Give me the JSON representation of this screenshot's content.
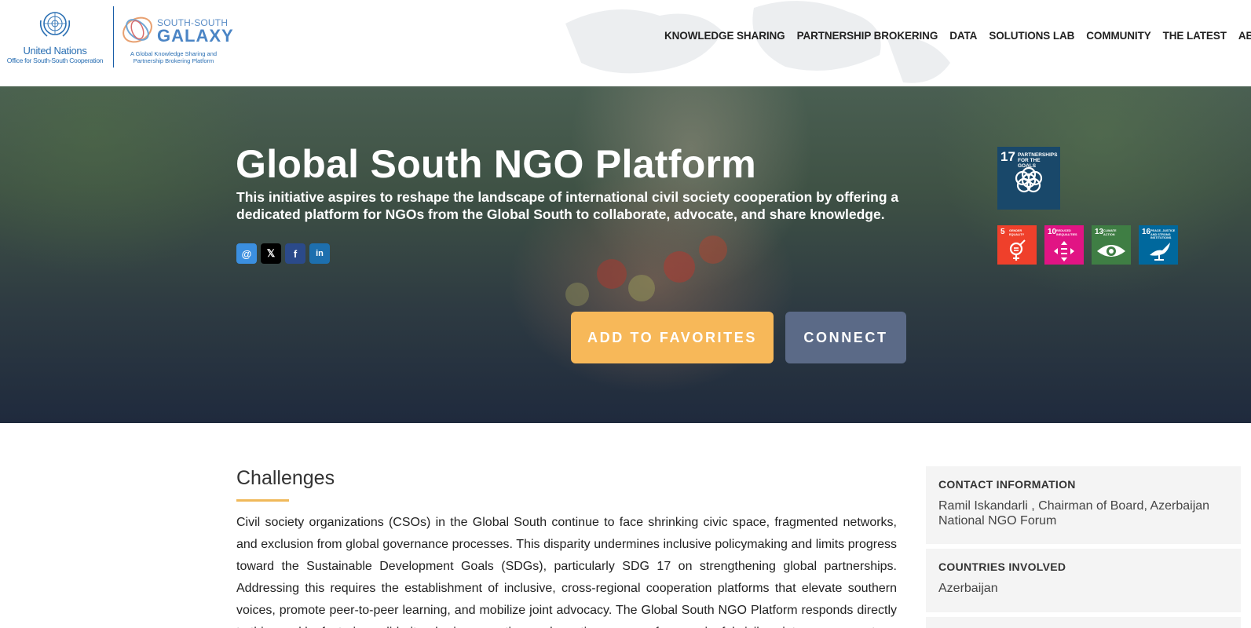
{
  "header": {
    "un_logo": {
      "name": "United Nations",
      "subtitle": "Office for South-South Cooperation"
    },
    "ssg_logo": {
      "top": "SOUTH-SOUTH",
      "brand": "GALAXY",
      "tagline": "A Global Knowledge Sharing and Partnership Brokering Platform"
    },
    "nav": [
      "KNOWLEDGE SHARING",
      "PARTNERSHIP BROKERING",
      "DATA",
      "SOLUTIONS LAB",
      "COMMUNITY",
      "THE LATEST",
      "ABOUT"
    ]
  },
  "hero": {
    "title": "Global South NGO Platform",
    "description": "This initiative aspires to reshape the landscape of international civil society cooperation by offering a dedicated platform for NGOs from the Global South to collaborate, advocate, and share knowledge.",
    "share": {
      "email_icon": "@",
      "x_icon": "𝕏",
      "facebook_icon": "f",
      "linkedin_icon": "in"
    },
    "buttons": {
      "favorites": "ADD TO FAVORITES",
      "connect": "CONNECT"
    },
    "sdgs": [
      {
        "number": "17",
        "label": "PARTNERSHIPS FOR THE GOALS",
        "color": "#19486a"
      },
      {
        "number": "5",
        "label": "GENDER EQUALITY",
        "color": "#ef402b"
      },
      {
        "number": "10",
        "label": "REDUCED INEQUALITIES",
        "color": "#e11484"
      },
      {
        "number": "13",
        "label": "CLIMATE ACTION",
        "color": "#3f7e44"
      },
      {
        "number": "16",
        "label": "PEACE, JUSTICE AND STRONG INSTITUTIONS",
        "color": "#00689d"
      }
    ]
  },
  "main": {
    "challenges_title": "Challenges",
    "challenges_body": "Civil society organizations (CSOs) in the Global South continue to face shrinking civic space, fragmented networks, and exclusion from global governance processes. This disparity undermines inclusive policymaking and limits progress toward the Sustainable Development Goals (SDGs), particularly SDG 17 on strengthening global partnerships. Addressing this requires the establishment of inclusive, cross-regional cooperation platforms that elevate southern voices, promote peer-to-peer learning, and mobilize joint advocacy. The Global South NGO Platform responds directly to this need by fostering solidarity, sharing expertise, and creating avenues for meaningful civil society engagement"
  },
  "sidebar": {
    "contact": {
      "heading": "CONTACT INFORMATION",
      "value": "Ramil Iskandarli , Chairman of Board, Azerbaijan National NGO Forum"
    },
    "countries": {
      "heading": "COUNTRIES INVOLVED",
      "value": "Azerbaijan"
    }
  },
  "colors": {
    "accent_orange": "#f7b859",
    "connect_slate": "#5b6a87",
    "brand_blue": "#2a6fb3"
  }
}
